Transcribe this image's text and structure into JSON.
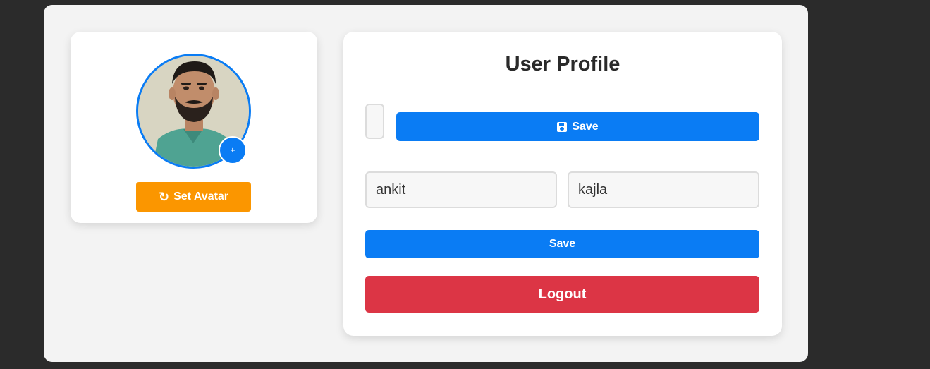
{
  "avatar": {
    "add_label": "+",
    "set_avatar_label": "Set Avatar",
    "set_avatar_icon": "refresh-icon",
    "border_color": "#0a7cf4"
  },
  "profile": {
    "title": "User Profile",
    "save_avatar_label": "Save",
    "save_avatar_icon": "floppy-disk-icon",
    "first_name": "ankit",
    "last_name": "kajla",
    "save_label": "Save",
    "logout_label": "Logout"
  },
  "colors": {
    "primary": "#0a7cf4",
    "warning": "#fb9600",
    "danger": "#dc3545",
    "page_bg": "#2b2b2b",
    "container_bg": "#f3f3f3"
  }
}
